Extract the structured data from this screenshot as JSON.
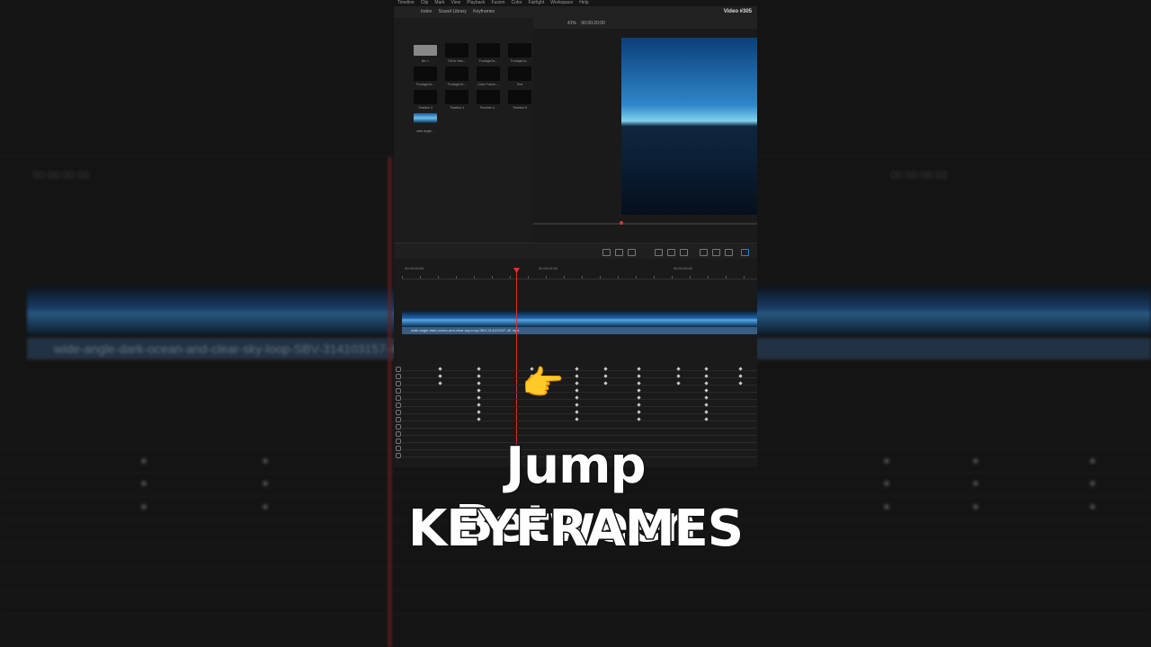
{
  "menu": [
    "Timeline",
    "Clip",
    "Mark",
    "View",
    "Playback",
    "Fusion",
    "Color",
    "Fairlight",
    "Workspace",
    "Help"
  ],
  "toolbar": {
    "index": "Index",
    "sound_library": "Sound Library",
    "keyframes": "Keyframes"
  },
  "project_title": "Video #305",
  "viewer": {
    "zoom": "41%",
    "timecode": "00:00:20:00"
  },
  "media_pool": [
    {
      "label": "Bin 1"
    },
    {
      "label": "Off for tess..."
    },
    {
      "label": "FootageCa..."
    },
    {
      "label": "FootageCa..."
    },
    {
      "label": "FootageCa..."
    },
    {
      "label": "FootageCa..."
    },
    {
      "label": "Color Fusion ..."
    },
    {
      "label": "Text"
    },
    {
      "label": "Timeline 3"
    },
    {
      "label": "Timeline 4"
    },
    {
      "label": "Timeline 4..."
    },
    {
      "label": "Timeline 5"
    },
    {
      "label": "wide-angle..."
    }
  ],
  "timeline": {
    "timecodes": [
      "00:00:00:00",
      "00:00:04:00",
      "00:00:08:00"
    ],
    "clip_name": "wide-angle-dark-ocean-and-clear-sky-loop-SBV-314103157-4K",
    "clip_ext": "mp4"
  },
  "background": {
    "timecode_left": "00:00:00:00",
    "timecode_right": "00:00:08:00",
    "clip_label": "wide-angle-dark-ocean-and-clear-sky-loop-SBV-314103157-4K"
  },
  "overlay": {
    "line1": "Jump Between",
    "line2": "KEYFRAMES",
    "emoji": "👉"
  }
}
